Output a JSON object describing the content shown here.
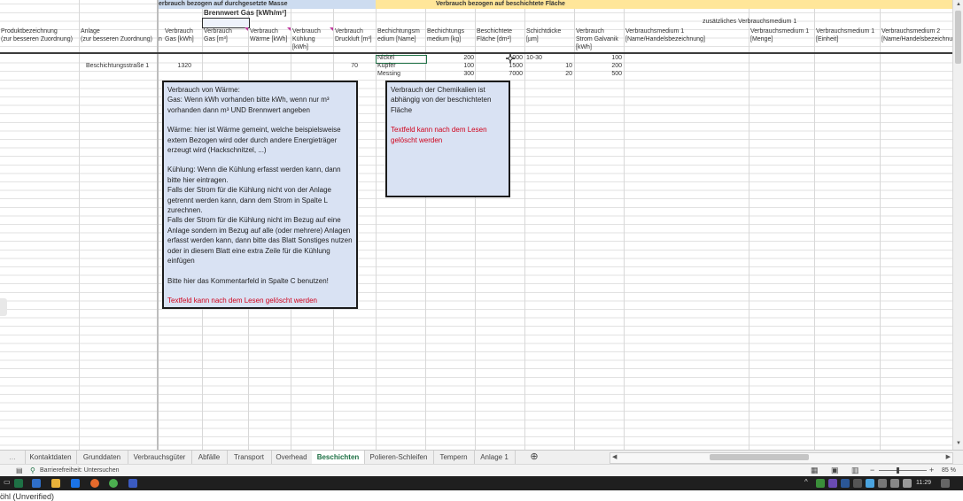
{
  "bands": {
    "mass": "erbrauch bezogen auf durchgesetzte Masse",
    "area": "Verbrauch bezogen auf beschichtete Fläche",
    "brennwert": "Brennwert Gas [kWh/m³]",
    "extra_medium": "zusätzliches Verbrauchsmedium 1"
  },
  "headers": [
    {
      "l1": "Produktbezeichnung",
      "l2": "(zur besseren Zuordnung)"
    },
    {
      "l1": "Anlage",
      "l2": "(zur besseren Zuordnung)"
    },
    {
      "l1": "n",
      "l2": ""
    },
    {
      "l1": "Verbrauch",
      "l2": "Gas [kWh]"
    },
    {
      "l1": "Verbrauch",
      "l2": "Gas [m³]"
    },
    {
      "l1": "Verbrauch",
      "l2": "Wärme [kWh]"
    },
    {
      "l1": "Verbrauch",
      "l2": "Kühlung",
      "l3": "[kWh]"
    },
    {
      "l1": "Verbrauch",
      "l2": "Druckluft [m³]"
    },
    {
      "l1": "Bechichtungsm",
      "l2": "edium [Name]"
    },
    {
      "l1": "Bechichtungs",
      "l2": "medium [kg]"
    },
    {
      "l1": "Beschichtete",
      "l2": "Fläche [dm²]"
    },
    {
      "l1": "Schichtdicke",
      "l2": "[µm]"
    },
    {
      "l1": "Verbrauch",
      "l2": "Strom Galvanik",
      "l3": "[kWh]"
    },
    {
      "l1": "Verbrauchsmedium 1",
      "l2": "[Name/Handelsbezeichnung]"
    },
    {
      "l1": "Verbrauchsmedium 1",
      "l2": "[Menge]"
    },
    {
      "l1": "Verbrauchsmedium 1",
      "l2": "[Einheit]"
    },
    {
      "l1": "Verbrauchsmedium 2",
      "l2": "[Name/Handelsbezeichnung]"
    }
  ],
  "row_main": {
    "anlage": "Beschichtungsstraße 1",
    "gas_kwh": "1320",
    "druckluft": "70"
  },
  "media_rows": [
    {
      "name": "Nickel",
      "kg": "200",
      "flaeche": "1000",
      "schicht": "10-30",
      "strom": "100"
    },
    {
      "name": "Kupfer",
      "kg": "100",
      "flaeche": "1500",
      "schicht": "10",
      "strom": "200"
    },
    {
      "name": "Messing",
      "kg": "300",
      "flaeche": "7000",
      "schicht": "20",
      "strom": "500"
    }
  ],
  "note1": {
    "p1": "Verbrauch von Wärme:\nGas: Wenn kWh vorhanden bitte kWh, wenn nur m³ vorhanden dann m³ UND Brennwert angeben",
    "p2": "Wärme: hier ist Wärme gemeint, welche beispielsweise extern Bezogen wird oder durch andere Energieträger erzeugt wird (Hackschnitzel, ...)",
    "p3": "Kühlung:  Wenn die Kühlung erfasst werden kann, dann bitte hier eintragen.\nFalls der Strom für die Kühlung nicht von der Anlage getrennt werden kann, dann dem Strom in Spalte L zurechnen.\nFalls der Strom für die Kühlung nicht im Bezug auf eine Anlage sondern im Bezug auf alle (oder mehrere) Anlagen erfasst werden kann, dann bitte das Blatt Sonstiges nutzen oder in diesem Blatt eine extra Zeile für die Kühlung einfügen",
    "p4": "Bitte hier das Kommentarfeld in Spalte C benutzen!",
    "p5": "Textfeld kann nach dem Lesen gelöscht werden"
  },
  "note2": {
    "p1": "Verbrauch der Chemikalien ist abhängig von der beschichteten Fläche",
    "p2": "Textfeld kann nach dem Lesen gelöscht werden"
  },
  "tabs": [
    "Kontaktdaten",
    "Grunddaten",
    "Verbrauchsgüter",
    "Abfälle",
    "Transport",
    "Overhead",
    "Beschichten",
    "Polieren-Schleifen",
    "Tempern",
    "Anlage 1"
  ],
  "active_tab": "Beschichten",
  "status": {
    "accessibility": "Barrierefreiheit: Untersuchen",
    "zoom": "85 %",
    "time": "11:29"
  },
  "bottom_fragment": "öhl (Unverified)",
  "colors": {
    "accent": "#1e7145",
    "band_blue": "#cddcf0",
    "band_yellow": "#ffe699",
    "note_bg": "#d9e2f3",
    "note_red": "#d0021b"
  }
}
